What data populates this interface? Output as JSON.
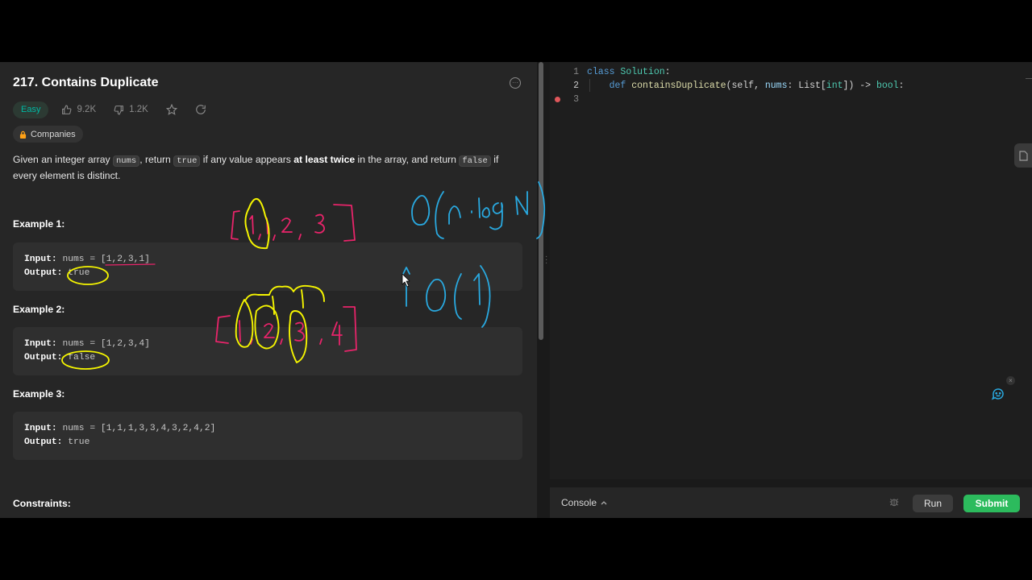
{
  "problem": {
    "title": "217. Contains Duplicate",
    "difficulty": "Easy",
    "likes": "9.2K",
    "dislikes": "1.2K",
    "companies_label": "Companies",
    "description": {
      "p1": "Given an integer array ",
      "code_nums": "nums",
      "p2": ", return ",
      "code_true": "true",
      "p3": " if any value appears ",
      "bold": "at least twice",
      "p4": " in the array, and return ",
      "code_false": "false",
      "p5": " if every element is distinct."
    },
    "examples": [
      {
        "title": "Example 1:",
        "input_label": "Input:",
        "input": " nums = [1,2,3,1]",
        "output_label": "Output:",
        "output": " true"
      },
      {
        "title": "Example 2:",
        "input_label": "Input:",
        "input": " nums = [1,2,3,4]",
        "output_label": "Output:",
        "output": " false"
      },
      {
        "title": "Example 3:",
        "input_label": "Input:",
        "input": " nums = [1,1,1,3,3,4,3,2,4,2]",
        "output_label": "Output:",
        "output": " true"
      }
    ],
    "constraints_title": "Constraints:"
  },
  "editor": {
    "line_numbers": [
      "1",
      "2",
      "3"
    ],
    "line1": {
      "kw": "class",
      "rest": " ",
      "cls": "Solution",
      "end": ":"
    },
    "line2": {
      "indent": "    ",
      "kw": "def",
      "sp": " ",
      "fn": "containsDuplicate",
      "a": "(self, ",
      "prm": "nums",
      "b": ": List[",
      "t1": "int",
      "c": "]) -> ",
      "t2": "bool",
      "d": ":"
    }
  },
  "console": {
    "label": "Console",
    "run_label": "Run",
    "submit_label": "Submit"
  },
  "colors": {
    "accent_green": "#2cbb5d",
    "easy": "#00b8a3",
    "ink_yellow": "#f5f500",
    "ink_pink": "#e8246a",
    "ink_blue": "#29a9e0"
  },
  "icons": [
    "thumbs-up-icon",
    "thumbs-down-icon",
    "star-icon",
    "share-icon",
    "lock-icon",
    "more-icon",
    "bug-icon",
    "chat-icon",
    "file-icon",
    "cursor-icon"
  ]
}
